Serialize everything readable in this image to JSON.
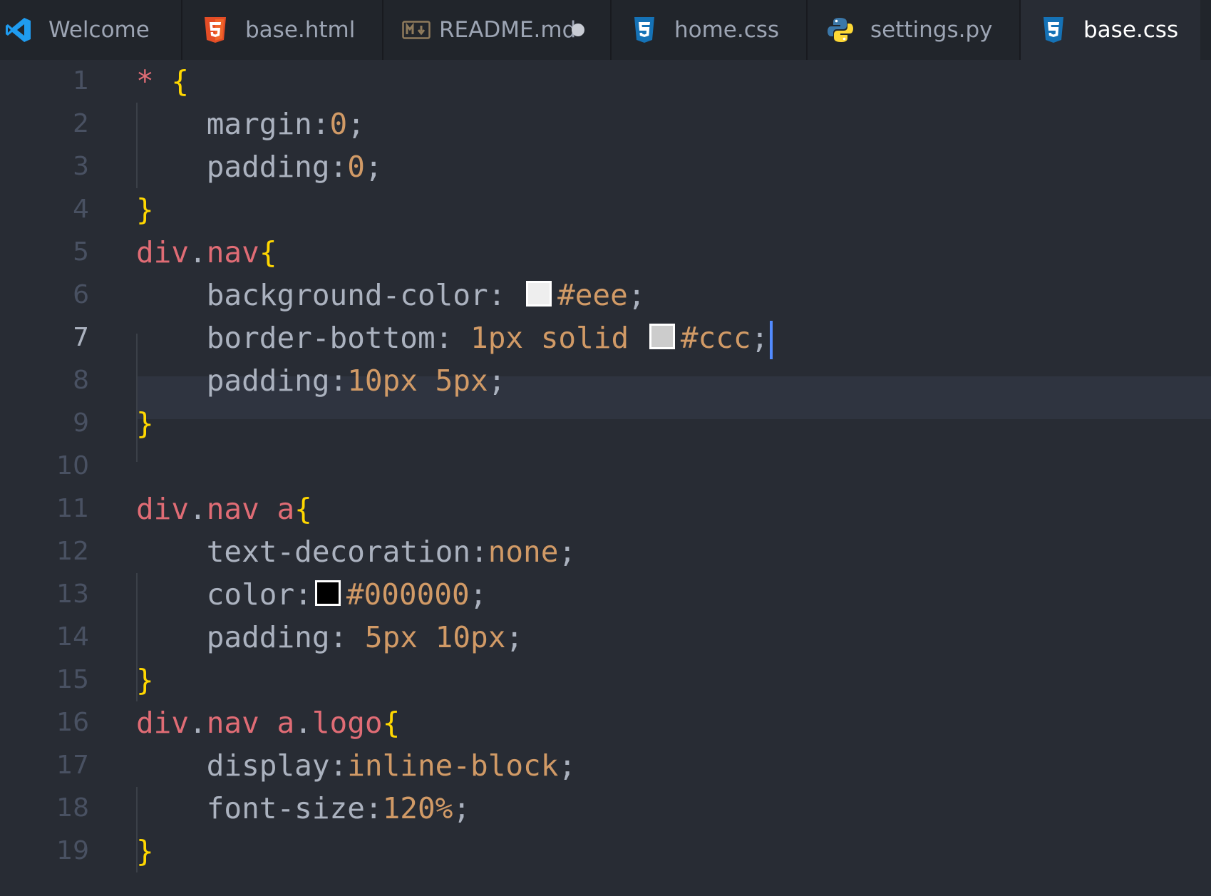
{
  "tabs": [
    {
      "label": "Welcome",
      "icon": "vscode-icon",
      "active": false
    },
    {
      "label": "base.html",
      "icon": "html5-icon",
      "active": false
    },
    {
      "label": "README.md",
      "icon": "markdown-icon",
      "active": false,
      "dirty": true
    },
    {
      "label": "home.css",
      "icon": "css3-icon",
      "active": false
    },
    {
      "label": "settings.py",
      "icon": "python-icon",
      "active": false
    },
    {
      "label": "base.css",
      "icon": "css3-icon",
      "active": true
    }
  ],
  "editor": {
    "line_numbers": [
      "1",
      "2",
      "3",
      "4",
      "5",
      "6",
      "7",
      "8",
      "9",
      "10",
      "11",
      "12",
      "13",
      "14",
      "15",
      "16",
      "17",
      "18",
      "19"
    ],
    "current_line": 7,
    "lines": [
      [
        [
          "sel",
          "*"
        ],
        [
          "punc",
          " "
        ],
        [
          "brace",
          "{"
        ]
      ],
      [
        [
          "prop",
          "    margin"
        ],
        [
          "punc",
          ":"
        ],
        [
          "val",
          "0"
        ],
        [
          "punc",
          ";"
        ]
      ],
      [
        [
          "prop",
          "    padding"
        ],
        [
          "punc",
          ":"
        ],
        [
          "val",
          "0"
        ],
        [
          "punc",
          ";"
        ]
      ],
      [
        [
          "brace",
          "}"
        ]
      ],
      [
        [
          "sel",
          "div"
        ],
        [
          "punc",
          "."
        ],
        [
          "sel",
          "nav"
        ],
        [
          "brace",
          "{"
        ]
      ],
      [
        [
          "prop",
          "    background-color"
        ],
        [
          "punc",
          ": "
        ],
        [
          "swatch",
          "#eeeeee"
        ],
        [
          "val",
          "#eee"
        ],
        [
          "punc",
          ";"
        ]
      ],
      [
        [
          "prop",
          "    border-bottom"
        ],
        [
          "punc",
          ": "
        ],
        [
          "val",
          "1px solid "
        ],
        [
          "swatch",
          "#cccccc"
        ],
        [
          "val",
          "#ccc"
        ],
        [
          "punc",
          ";"
        ]
      ],
      [
        [
          "prop",
          "    padding"
        ],
        [
          "punc",
          ":"
        ],
        [
          "val",
          "10px 5px"
        ],
        [
          "punc",
          ";"
        ]
      ],
      [
        [
          "brace",
          "}"
        ]
      ],
      [],
      [
        [
          "sel",
          "div"
        ],
        [
          "punc",
          "."
        ],
        [
          "sel",
          "nav a"
        ],
        [
          "brace",
          "{"
        ]
      ],
      [
        [
          "prop",
          "    text-decoration"
        ],
        [
          "punc",
          ":"
        ],
        [
          "val",
          "none"
        ],
        [
          "punc",
          ";"
        ]
      ],
      [
        [
          "prop",
          "    color"
        ],
        [
          "punc",
          ":"
        ],
        [
          "swatch",
          "#000000"
        ],
        [
          "val",
          "#000000"
        ],
        [
          "punc",
          ";"
        ]
      ],
      [
        [
          "prop",
          "    padding"
        ],
        [
          "punc",
          ": "
        ],
        [
          "val",
          "5px 10px"
        ],
        [
          "punc",
          ";"
        ]
      ],
      [
        [
          "brace",
          "}"
        ]
      ],
      [
        [
          "sel",
          "div"
        ],
        [
          "punc",
          "."
        ],
        [
          "sel",
          "nav a"
        ],
        [
          "punc",
          "."
        ],
        [
          "sel",
          "logo"
        ],
        [
          "brace",
          "{"
        ]
      ],
      [
        [
          "prop",
          "    display"
        ],
        [
          "punc",
          ":"
        ],
        [
          "val",
          "inline-block"
        ],
        [
          "punc",
          ";"
        ]
      ],
      [
        [
          "prop",
          "    font-size"
        ],
        [
          "punc",
          ":"
        ],
        [
          "val",
          "120%"
        ],
        [
          "punc",
          ";"
        ]
      ],
      [
        [
          "brace",
          "}"
        ]
      ]
    ]
  },
  "colors": {
    "selector": "#e06c75",
    "brace": "#ffd700",
    "property": "#abb2bf",
    "value": "#d19a66",
    "background": "#282c34",
    "cursor": "#528bff"
  }
}
